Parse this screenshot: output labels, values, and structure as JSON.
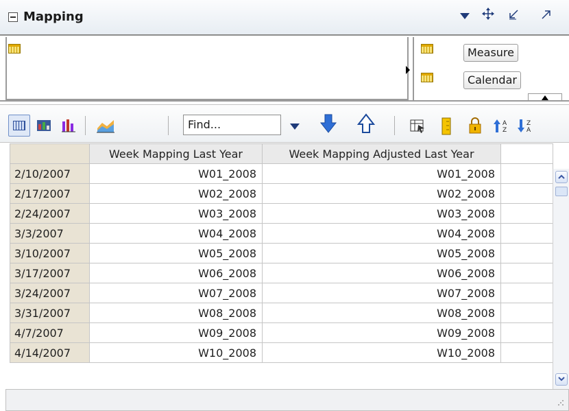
{
  "header": {
    "title": "Mapping",
    "icons": [
      "triangle-down",
      "move",
      "shrink",
      "expand"
    ]
  },
  "pivot": {
    "row_items": [],
    "column_items": [
      {
        "label": "Measure"
      },
      {
        "label": "Calendar"
      }
    ]
  },
  "toolbar": {
    "find_value": "Find...",
    "icons": [
      "table-view",
      "chart-table-view",
      "bar-chart",
      "area-chart",
      "find-next-down",
      "find-prev-up",
      "export",
      "highlight",
      "lock",
      "sort-ascending",
      "sort-descending"
    ]
  },
  "table": {
    "columns": [
      "",
      "Week Mapping Last Year",
      "Week Mapping Adjusted Last Year",
      ""
    ],
    "rows": [
      {
        "date": "2/10/2007",
        "last_year": "W01_2008",
        "adjusted": "W01_2008"
      },
      {
        "date": "2/17/2007",
        "last_year": "W02_2008",
        "adjusted": "W02_2008"
      },
      {
        "date": "2/24/2007",
        "last_year": "W03_2008",
        "adjusted": "W03_2008"
      },
      {
        "date": "3/3/2007",
        "last_year": "W04_2008",
        "adjusted": "W04_2008"
      },
      {
        "date": "3/10/2007",
        "last_year": "W05_2008",
        "adjusted": "W05_2008"
      },
      {
        "date": "3/17/2007",
        "last_year": "W06_2008",
        "adjusted": "W06_2008"
      },
      {
        "date": "3/24/2007",
        "last_year": "W07_2008",
        "adjusted": "W07_2008"
      },
      {
        "date": "3/31/2007",
        "last_year": "W08_2008",
        "adjusted": "W08_2008"
      },
      {
        "date": "4/7/2007",
        "last_year": "W09_2008",
        "adjusted": "W09_2008"
      },
      {
        "date": "4/14/2007",
        "last_year": "W10_2008",
        "adjusted": "W10_2008"
      }
    ]
  },
  "colors": {
    "row_header_bg": "#e9e3d4",
    "header_bg": "#eaeaea",
    "accent_blue": "#1f3b7a",
    "grid_icon": "#e1a800"
  }
}
